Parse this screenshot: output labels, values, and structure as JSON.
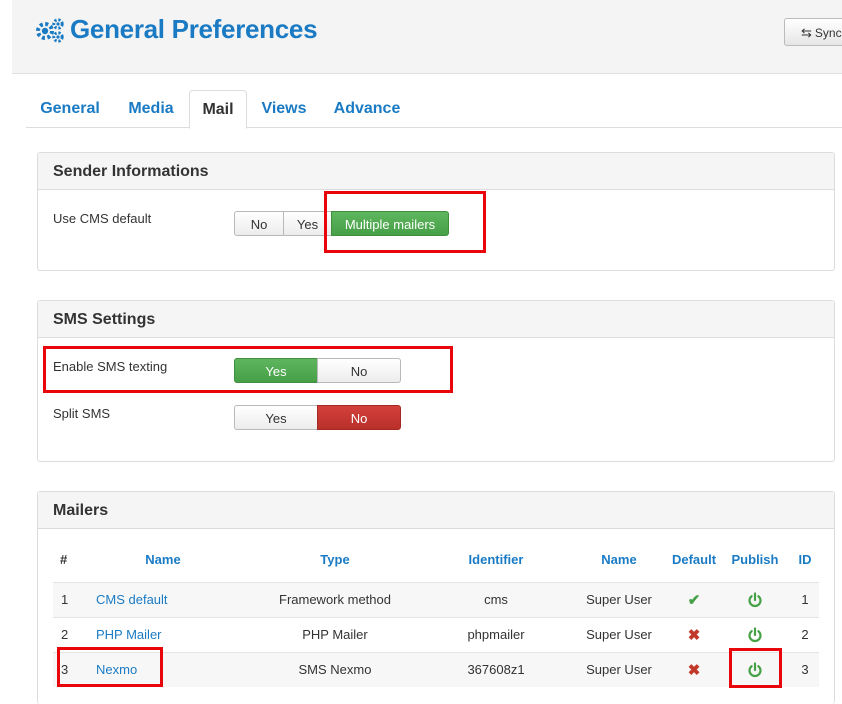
{
  "header": {
    "title": "General Preferences",
    "sync_label": "Sync"
  },
  "tabs": [
    {
      "label": "General"
    },
    {
      "label": "Media"
    },
    {
      "label": "Mail",
      "active": true
    },
    {
      "label": "Views"
    },
    {
      "label": "Advance"
    }
  ],
  "sender": {
    "heading": "Sender Informations",
    "use_cms_default": {
      "label": "Use CMS default",
      "options": [
        "No",
        "Yes",
        "Multiple mailers"
      ],
      "selected": "Multiple mailers"
    }
  },
  "sms": {
    "heading": "SMS Settings",
    "enable": {
      "label": "Enable SMS texting",
      "options": [
        "Yes",
        "No"
      ],
      "selected": "Yes"
    },
    "split": {
      "label": "Split SMS",
      "options": [
        "Yes",
        "No"
      ],
      "selected": "No"
    }
  },
  "mailers": {
    "heading": "Mailers",
    "columns": [
      "#",
      "Name",
      "Type",
      "Identifier",
      "Name",
      "Default",
      "Publish",
      "ID"
    ],
    "rows": [
      {
        "num": "1",
        "name": "CMS default",
        "type": "Framework method",
        "identifier": "cms",
        "owner": "Super User",
        "default": true,
        "published": true,
        "id": "1"
      },
      {
        "num": "2",
        "name": "PHP Mailer",
        "type": "PHP Mailer",
        "identifier": "phpmailer",
        "owner": "Super User",
        "default": false,
        "published": true,
        "id": "2"
      },
      {
        "num": "3",
        "name": "Nexmo",
        "type": "SMS Nexmo",
        "identifier": "367608z1",
        "owner": "Super User",
        "default": false,
        "published": true,
        "id": "3"
      }
    ]
  },
  "colors": {
    "accent": "#1a7bc4",
    "success": "#46a046",
    "danger": "#c0392b",
    "highlight": "#e8060b"
  }
}
